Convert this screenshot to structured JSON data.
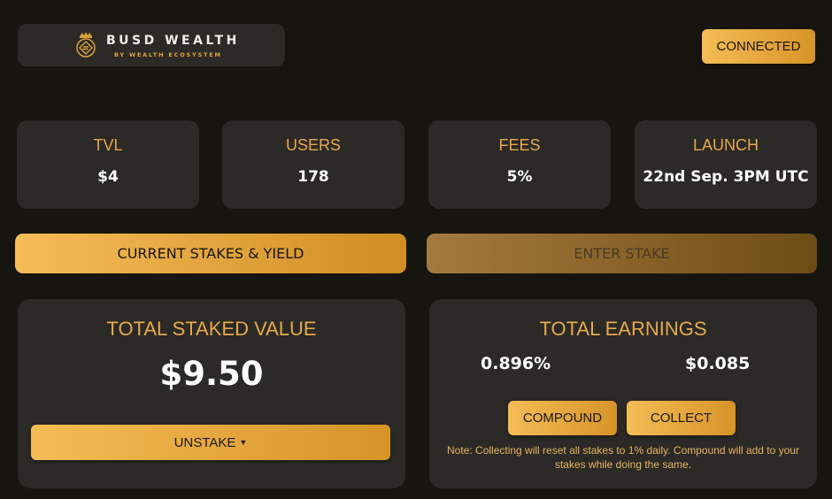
{
  "header": {
    "logo_title": "BUSD WEALTH",
    "logo_subtitle": "BY WEALTH ECOSYSTEM",
    "logo_icon": "crown-diamond-icon",
    "connect_label": "CONNECTED"
  },
  "stats": [
    {
      "label": "TVL",
      "value": "$4"
    },
    {
      "label": "USERS",
      "value": "178"
    },
    {
      "label": "FEES",
      "value": "5%"
    },
    {
      "label": "LAUNCH",
      "value": "22nd Sep. 3PM UTC"
    }
  ],
  "tabs": {
    "stakes_label": "CURRENT STAKES & YIELD",
    "enter_label": "ENTER STAKE",
    "active": "CURRENT STAKES & YIELD"
  },
  "staked": {
    "title": "TOTAL STAKED VALUE",
    "value": "$9.50",
    "unstake_label": "UNSTAKE"
  },
  "earnings": {
    "title": "TOTAL EARNINGS",
    "percent": "0.896%",
    "amount": "$0.085",
    "compound_label": "COMPOUND",
    "collect_label": "COLLECT",
    "note": "Note: Collecting will reset all stakes to 1% daily. Compound will add to your stakes while doing the same."
  },
  "colors": {
    "background": "#17150f",
    "card": "#2b2a27",
    "accent": "#e8a84b",
    "button_start": "#f5bc55",
    "button_end": "#d69428"
  }
}
